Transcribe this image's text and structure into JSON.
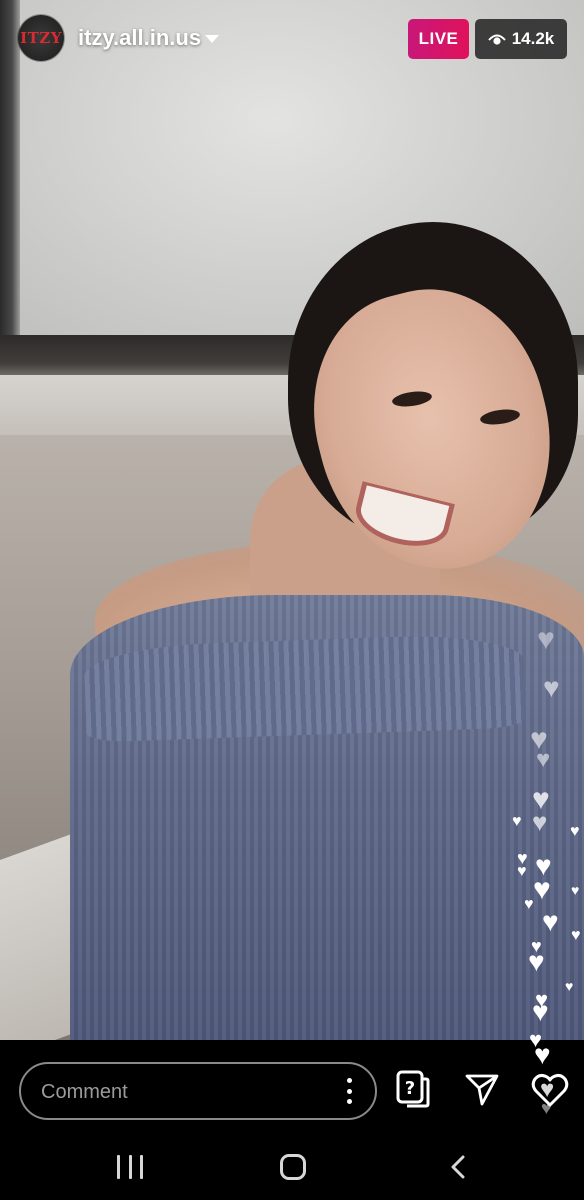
{
  "header": {
    "avatar_text": "ITZY",
    "username": "itzy.all.in.us",
    "live_label": "LIVE",
    "viewer_count": "14.2k"
  },
  "footer": {
    "comment_placeholder": "Comment"
  },
  "icons": {
    "avatar": "itzy-logo-avatar",
    "caret": "chevron-down-icon",
    "viewers": "eye-icon",
    "more": "more-vertical-icon",
    "question": "question-sticker-icon",
    "send": "paper-plane-icon",
    "like": "heart-icon",
    "nav_recents": "recents-icon",
    "nav_home": "home-icon",
    "nav_back": "back-icon"
  },
  "colors": {
    "live_badge": "#d91463",
    "viewer_badge": "#222222",
    "avatar_logo": "#d92b30"
  }
}
